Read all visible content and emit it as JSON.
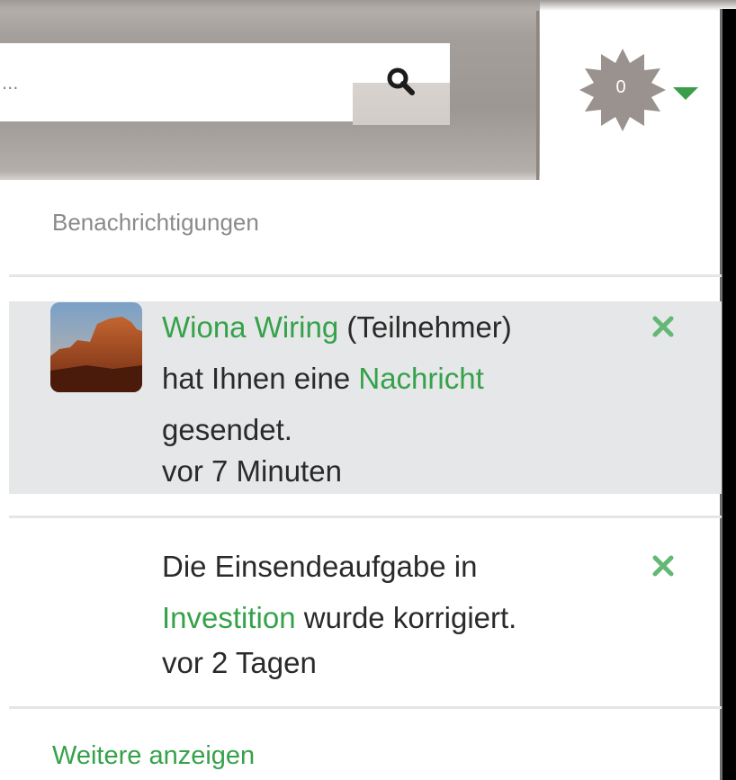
{
  "header": {
    "search": {
      "placeholder": "...",
      "value": ""
    },
    "notifications_badge": {
      "count": "0"
    }
  },
  "panel": {
    "title": "Benachrichtigungen",
    "items": [
      {
        "sender": "Wiona Wiring",
        "role": "(Teilnehmer)",
        "text_a": "hat Ihnen eine",
        "link": "Nachricht",
        "text_b": "gesendet.",
        "time": "vor 7 Minuten"
      },
      {
        "text_a": "Die Einsendeaufgabe in",
        "link": "Investition",
        "text_b": "wurde korrigiert.",
        "time": "vor 2 Tagen"
      }
    ],
    "more_label": "Weitere anzeigen"
  },
  "colors": {
    "accent_green": "#35a24a",
    "highlight_row": "#e6e7e8",
    "header_gray": "#a59f9b"
  },
  "icons": [
    "search-icon",
    "gear-badge-icon",
    "caret-down-icon",
    "close-icon"
  ]
}
